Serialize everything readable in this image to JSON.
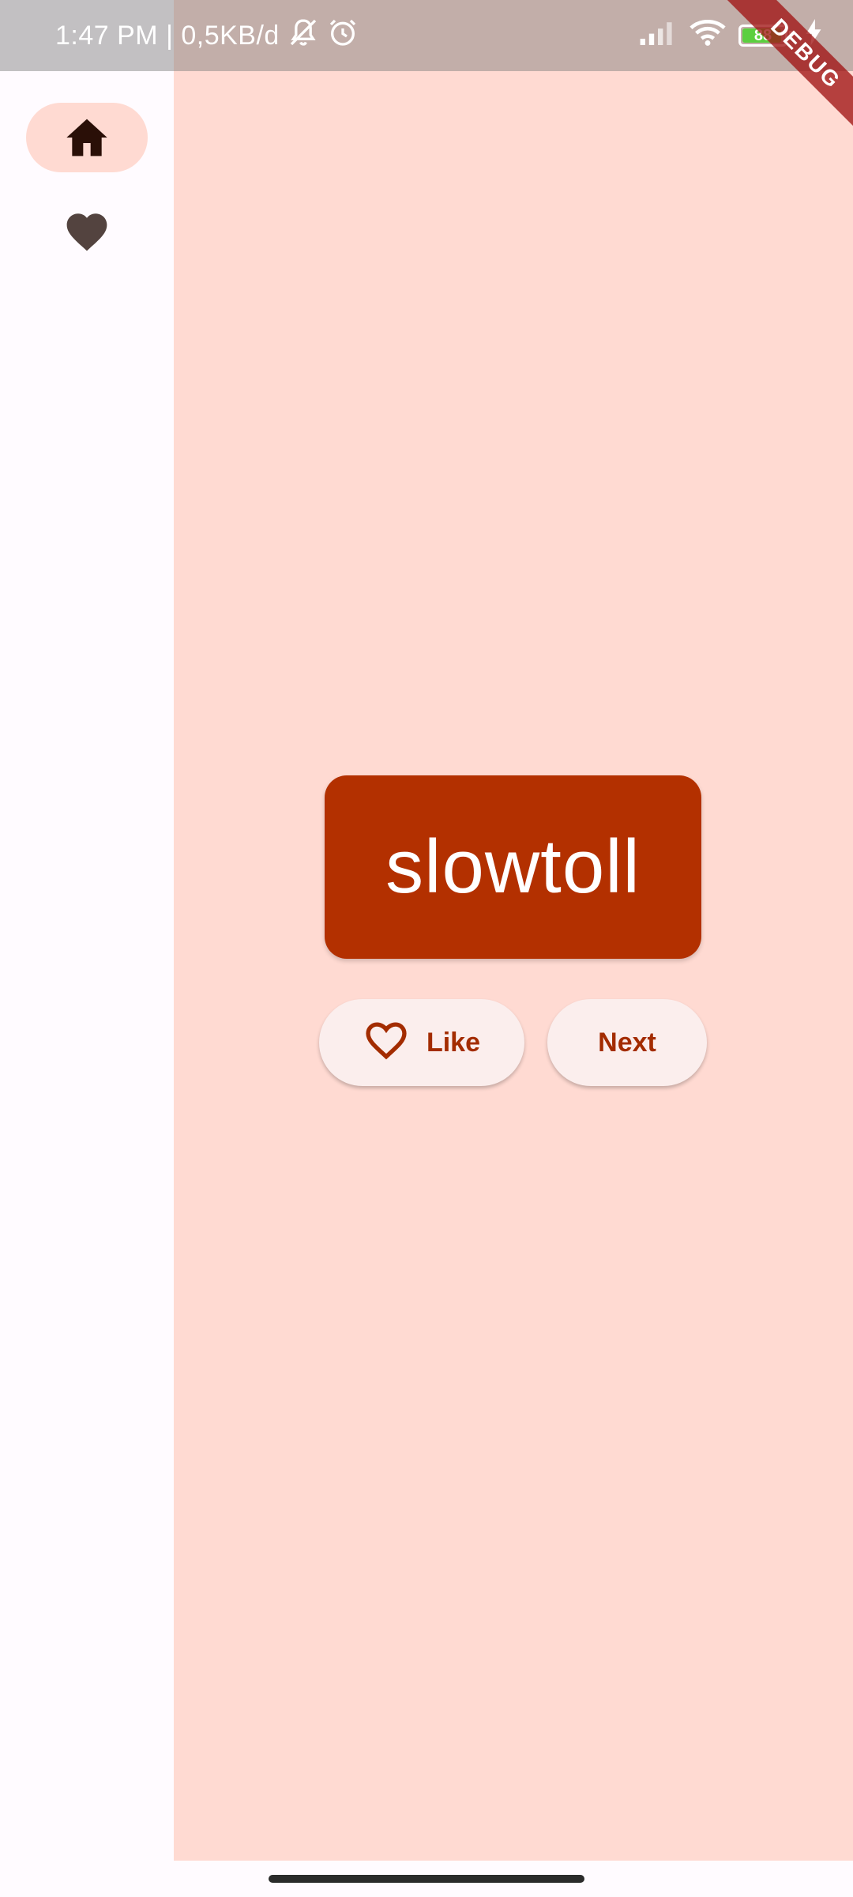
{
  "status_bar": {
    "time_info": "1:47 PM | 0,5KB/d",
    "battery_level": "88",
    "icons": [
      "mute-notification-icon",
      "alarm-icon",
      "signal-icon",
      "wifi-icon",
      "battery-icon",
      "charging-icon"
    ]
  },
  "debug_banner": "DEBUG",
  "nav_rail": {
    "items": [
      {
        "icon": "home-icon",
        "selected": true
      },
      {
        "icon": "heart-icon",
        "selected": false
      }
    ]
  },
  "word_card": {
    "word": "slowtoll"
  },
  "actions": {
    "like_label": "Like",
    "like_icon": "heart-outline-icon",
    "next_label": "Next"
  },
  "colors": {
    "main_bg": "#ffdad2",
    "rail_bg": "#fffbff",
    "card_bg": "#b33000",
    "button_bg": "#fbeeed",
    "button_text": "#a32c00",
    "selected_pill": "#ffdad2"
  }
}
